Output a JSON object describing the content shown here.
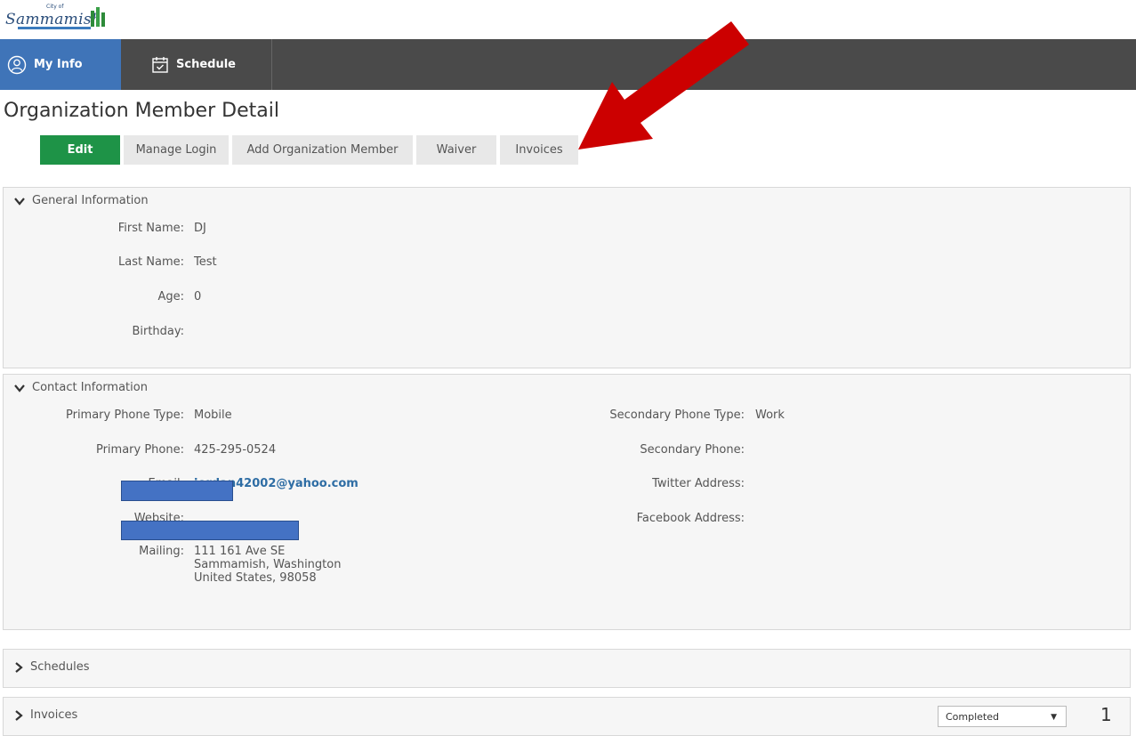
{
  "logo": {
    "city_of": "City of",
    "name": "Sammamish"
  },
  "nav": {
    "my_info": "My Info",
    "schedule": "Schedule"
  },
  "page_title": "Organization Member Detail",
  "buttons": {
    "edit": "Edit",
    "manage_login": "Manage Login",
    "add_member": "Add Organization Member",
    "waiver": "Waiver",
    "invoices": "Invoices"
  },
  "general": {
    "title": "General Information",
    "first_name_label": "First Name:",
    "first_name": "DJ",
    "last_name_label": "Last Name:",
    "last_name": "Test",
    "age_label": "Age:",
    "age": "0",
    "birthday_label": "Birthday:"
  },
  "contact": {
    "title": "Contact Information",
    "primary_phone_type_label": "Primary Phone Type:",
    "primary_phone_type": "Mobile",
    "primary_phone_label": "Primary Phone:",
    "primary_phone": "425-295-0524",
    "email_label": "Email:",
    "email": "jordan42002@yahoo.com",
    "website_label": "Website:",
    "mailing_label": "Mailing:",
    "mailing_line1": "111 161 Ave SE",
    "mailing_line2": "Sammamish, Washington",
    "mailing_line3": "United States, 98058",
    "secondary_phone_type_label": "Secondary Phone Type:",
    "secondary_phone_type": "Work",
    "secondary_phone_label": "Secondary Phone:",
    "twitter_label": "Twitter Address:",
    "facebook_label": "Facebook Address:"
  },
  "schedules": {
    "title": "Schedules"
  },
  "invoices": {
    "title": "Invoices",
    "status_select": "Completed",
    "page": "1"
  },
  "colors": {
    "nav_active": "#3f74b8",
    "edit_button": "#1e9347",
    "annotation_arrow": "#cc0000"
  }
}
